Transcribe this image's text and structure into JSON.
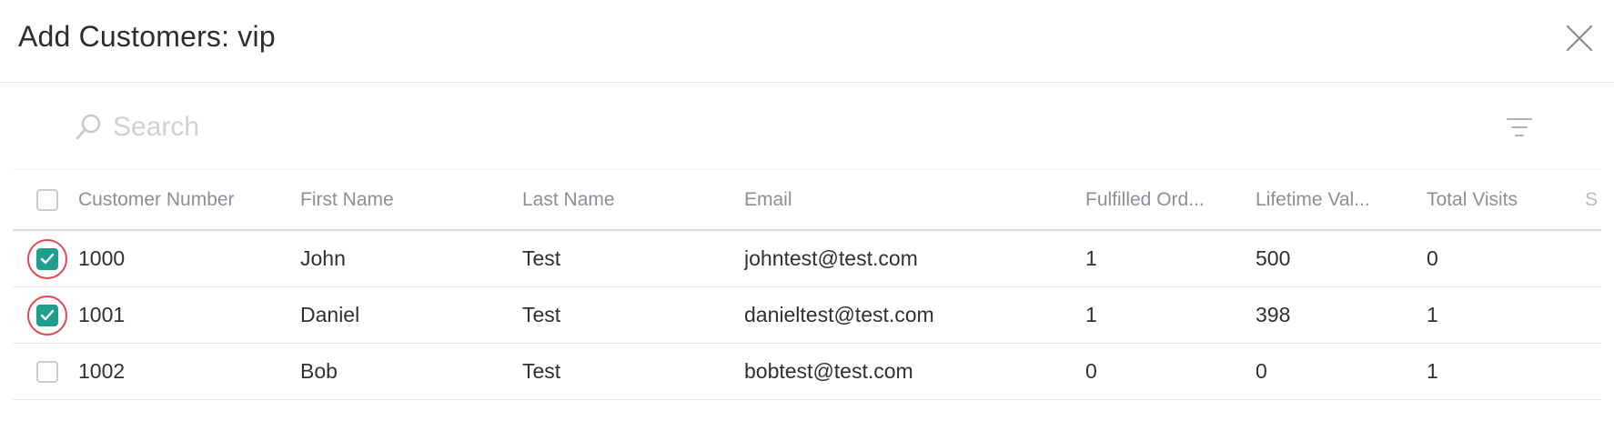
{
  "dialog": {
    "title": "Add Customers: vip"
  },
  "search": {
    "placeholder": "Search",
    "value": ""
  },
  "icons": {
    "close": "close-icon",
    "search": "search-icon",
    "filter": "filter-icon",
    "check": "check-icon"
  },
  "colors": {
    "accent": "#1f9e8f",
    "highlight": "#e0484c",
    "muted_text": "#8c8f96",
    "placeholder": "#cfd1d6"
  },
  "table": {
    "headers": {
      "customer_number": "Customer Number",
      "first_name": "First Name",
      "last_name": "Last Name",
      "email": "Email",
      "fulfilled_orders": "Fulfilled Ord...",
      "lifetime_value": "Lifetime Val...",
      "total_visits": "Total Visits",
      "extra": "S"
    },
    "select_all_checked": false,
    "rows": [
      {
        "checked": true,
        "customer_number": "1000",
        "first_name": "John",
        "last_name": "Test",
        "email": "johntest@test.com",
        "fulfilled_orders": "1",
        "lifetime_value": "500",
        "total_visits": "0"
      },
      {
        "checked": true,
        "customer_number": "1001",
        "first_name": "Daniel",
        "last_name": "Test",
        "email": "danieltest@test.com",
        "fulfilled_orders": "1",
        "lifetime_value": "398",
        "total_visits": "1"
      },
      {
        "checked": false,
        "customer_number": "1002",
        "first_name": "Bob",
        "last_name": "Test",
        "email": "bobtest@test.com",
        "fulfilled_orders": "0",
        "lifetime_value": "0",
        "total_visits": "1"
      }
    ]
  }
}
